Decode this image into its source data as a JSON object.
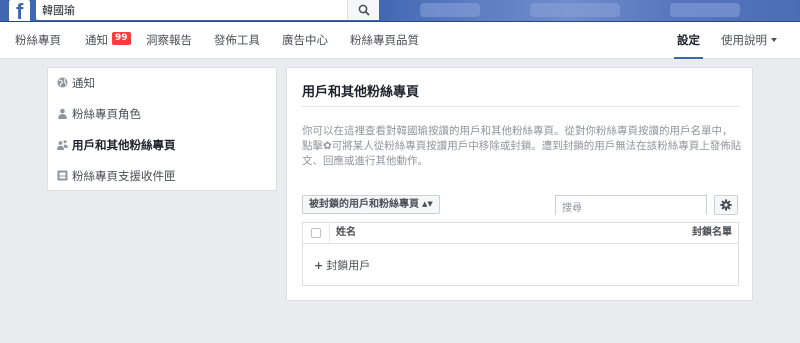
{
  "topbar": {
    "logo": "f",
    "search_value": "韓國瑜",
    "search_icon": "search-icon"
  },
  "page_nav": {
    "items": [
      {
        "label": "粉絲專頁"
      },
      {
        "label": "通知",
        "badge": "99"
      },
      {
        "label": "洞察報告"
      },
      {
        "label": "發佈工具"
      },
      {
        "label": "廣告中心"
      },
      {
        "label": "粉絲專頁品質"
      }
    ],
    "settings_label": "設定",
    "help_label": "使用說明"
  },
  "sidebar": {
    "items": [
      {
        "label": "通知",
        "icon": "globe-icon"
      },
      {
        "label": "粉絲專頁角色",
        "icon": "person-icon"
      },
      {
        "label": "用戶和其他粉絲專頁",
        "icon": "people-icon",
        "active": true
      },
      {
        "label": "粉絲專頁支援收件匣",
        "icon": "inbox-icon"
      }
    ]
  },
  "main": {
    "title": "用戶和其他粉絲專頁",
    "description": "你可以在這裡查看對韓國瑜按讚的用戶和其他粉絲專頁。從對你粉絲專頁按讚的用戶名單中，點擊✿可將某人從粉絲專頁按讚用戶中移除或封鎖。遭到封鎖的用戶無法在該粉絲專頁上發佈貼文、回應或進行其他動作。",
    "filter_label": "被封鎖的用戶和粉絲專頁",
    "search_placeholder": "搜尋",
    "table": {
      "col_name": "姓名",
      "col_blocked": "封鎖名單"
    },
    "add_label": "封鎖用戶"
  },
  "colors": {
    "brand_blue": "#4267b2",
    "badge_red": "#fa3e3e",
    "page_bg": "#e9ebee"
  }
}
